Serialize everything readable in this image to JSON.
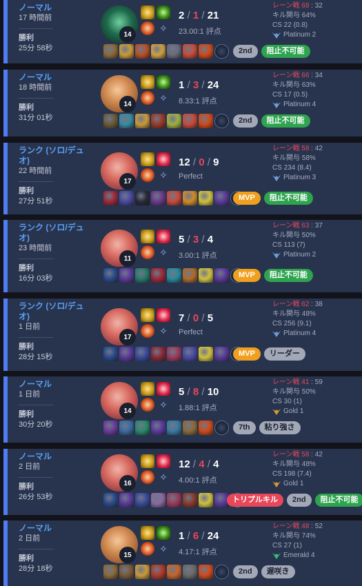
{
  "colors": {
    "accent": "#4f7ef4",
    "kill_death_red": "#e8475a",
    "mvp_orange": "#f0a01e",
    "unstoppable_green": "#2ea44f",
    "card_bg": "#28344e"
  },
  "matches": [
    {
      "mode": "ノーマル",
      "ago": "17 時間前",
      "result": "勝利",
      "duration": "25分 58秒",
      "champion": "green-champion-portrait",
      "level": "14",
      "spells": [
        "flash",
        "smite"
      ],
      "runes": [
        "keystone-rune",
        "secondary-rune"
      ],
      "kda": {
        "k": "2",
        "d": "1",
        "a": "21"
      },
      "ratio": "23.00:1 評点",
      "lane": "レーン戦 68",
      "lane_vs": "32",
      "kp": "キル関与 64%",
      "cs": "CS 22 (0.8)",
      "tier": "Platinum 2",
      "tier_color": "#6f9fd8",
      "items": [
        "#8a6a3a",
        "#c99a3a",
        "#b8502a",
        "#d0a040",
        "#6a6a7a",
        "#c84a3a",
        "#d04a1a"
      ],
      "badges": [
        {
          "text": "2nd",
          "style": "grey"
        },
        {
          "text": "阻止不可能",
          "style": "green"
        }
      ]
    },
    {
      "mode": "ノーマル",
      "ago": "18 時間前",
      "result": "勝利",
      "duration": "31分 01秒",
      "champion": "blonde-champion-portrait",
      "level": "14",
      "spells": [
        "flash",
        "smite"
      ],
      "runes": [
        "keystone-rune",
        "secondary-rune"
      ],
      "kda": {
        "k": "1",
        "d": "3",
        "a": "24"
      },
      "ratio": "8.33:1 評点",
      "lane": "レーン戦 66",
      "lane_vs": "34",
      "kp": "キル関与 63%",
      "cs": "CS 17 (0.5)",
      "tier": "Platinum 4",
      "tier_color": "#6f9fd8",
      "items": [
        "#6a5a3a",
        "#3a8aa0",
        "#c99a3a",
        "#9a3a2a",
        "#a0b040",
        "#c84a3a",
        "#d04a1a"
      ],
      "badges": [
        {
          "text": "2nd",
          "style": "grey"
        },
        {
          "text": "阻止不可能",
          "style": "green"
        }
      ]
    },
    {
      "mode": "ランク (ソロ/デュオ)",
      "ago": "22 時間前",
      "result": "勝利",
      "duration": "27分 51秒",
      "champion": "pink-champion-portrait",
      "level": "17",
      "spells": [
        "flash",
        "heal"
      ],
      "runes": [
        "keystone-rune",
        "secondary-rune"
      ],
      "kda": {
        "k": "12",
        "d": "0",
        "a": "9"
      },
      "ratio": "Perfect",
      "lane": "レーン戦 58",
      "lane_vs": "42",
      "kp": "キル関与 58%",
      "cs": "CS 234 (8.4)",
      "tier": "Platinum 3",
      "tier_color": "#6f9fd8",
      "items": [
        "#9a2a3a",
        "#4a4aa0",
        "#2a2a3a",
        "#6a3a8a",
        "#c84a3a",
        "#d08a2a",
        "#d0c040",
        "#5a3a9a"
      ],
      "badges": [
        {
          "text": "MVP",
          "style": "orange"
        },
        {
          "text": "阻止不可能",
          "style": "green"
        }
      ]
    },
    {
      "mode": "ランク (ソロ/デュオ)",
      "ago": "23 時間前",
      "result": "勝利",
      "duration": "16分 03秒",
      "champion": "pink-champion-portrait",
      "level": "11",
      "spells": [
        "flash",
        "heal"
      ],
      "runes": [
        "keystone-rune",
        "secondary-rune"
      ],
      "kda": {
        "k": "5",
        "d": "3",
        "a": "4"
      },
      "ratio": "3.00:1 評点",
      "lane": "レーン戦 63",
      "lane_vs": "37",
      "kp": "キル関与 50%",
      "cs": "CS 113 (7)",
      "tier": "Platinum 2",
      "tier_color": "#6f9fd8",
      "items": [
        "#2a4a8a",
        "#5a3a9a",
        "#2a7a6a",
        "#9a2a3a",
        "#2a8a9a",
        "#b06a2a",
        "#d0c040",
        "#5a3a9a"
      ],
      "badges": [
        {
          "text": "MVP",
          "style": "orange"
        },
        {
          "text": "阻止不可能",
          "style": "green"
        }
      ]
    },
    {
      "mode": "ランク (ソロ/デュオ)",
      "ago": "1 日前",
      "result": "勝利",
      "duration": "28分 15秒",
      "champion": "pink-champion-portrait",
      "level": "17",
      "spells": [
        "flash",
        "heal"
      ],
      "runes": [
        "keystone-rune",
        "secondary-rune"
      ],
      "kda": {
        "k": "7",
        "d": "0",
        "a": "5"
      },
      "ratio": "Perfect",
      "lane": "レーン戦 62",
      "lane_vs": "38",
      "kp": "キル関与 48%",
      "cs": "CS 256 (9.1)",
      "tier": "Platinum 4",
      "tier_color": "#6f9fd8",
      "items": [
        "#2a4a8a",
        "#5a3a9a",
        "#3a4a9a",
        "#8a2a3a",
        "#9a3a5a",
        "#4a4aa0",
        "#d0c040",
        "#5a3a9a"
      ],
      "badges": [
        {
          "text": "MVP",
          "style": "orange"
        },
        {
          "text": "リーダー",
          "style": "grey"
        }
      ]
    },
    {
      "mode": "ノーマル",
      "ago": "1 日前",
      "result": "勝利",
      "duration": "30分 20秒",
      "champion": "pink-champion-portrait",
      "level": "14",
      "spells": [
        "flash",
        "heal"
      ],
      "runes": [
        "keystone-rune",
        "secondary-rune"
      ],
      "kda": {
        "k": "5",
        "d": "8",
        "a": "10"
      },
      "ratio": "1.88:1 評点",
      "lane": "レーン戦 41",
      "lane_vs": "59",
      "kp": "キル関与 50%",
      "cs": "CS 30 (1)",
      "tier": "Gold 1",
      "tier_color": "#d89a3a",
      "items": [
        "#6a3a9a",
        "#3a6aa0",
        "#2a8a6a",
        "#5a3a9a",
        "#3a7aa0",
        "#8a6a3a",
        "#d04a1a"
      ],
      "badges": [
        {
          "text": "7th",
          "style": "grey"
        },
        {
          "text": "粘り強さ",
          "style": "grey"
        }
      ]
    },
    {
      "mode": "ノーマル",
      "ago": "2 日前",
      "result": "勝利",
      "duration": "26分 53秒",
      "champion": "pink-champion-portrait",
      "level": "16",
      "spells": [
        "flash",
        "heal"
      ],
      "runes": [
        "keystone-rune",
        "secondary-rune"
      ],
      "kda": {
        "k": "12",
        "d": "4",
        "a": "4"
      },
      "ratio": "4.00:1 評点",
      "lane": "レーン戦 58",
      "lane_vs": "42",
      "kp": "キル関与 48%",
      "cs": "CS 198 (7.4)",
      "tier": "Gold 1",
      "tier_color": "#d89a3a",
      "items": [
        "#2a4a8a",
        "#5a3a9a",
        "#3a4a9a",
        "#8a6aa0",
        "#9a3a5a",
        "#8a3a2a",
        "#d0c040",
        "#5a3a9a"
      ],
      "badges": [
        {
          "text": "トリプルキル",
          "style": "red"
        },
        {
          "text": "2nd",
          "style": "grey"
        },
        {
          "text": "阻止不可能",
          "style": "green"
        }
      ]
    },
    {
      "mode": "ノーマル",
      "ago": "2 日前",
      "result": "勝利",
      "duration": "28分 18秒",
      "champion": "blonde-champion-portrait",
      "level": "15",
      "spells": [
        "flash",
        "smite"
      ],
      "runes": [
        "keystone-rune",
        "secondary-rune"
      ],
      "kda": {
        "k": "1",
        "d": "6",
        "a": "24"
      },
      "ratio": "4.17:1 評点",
      "lane": "レーン戦 48",
      "lane_vs": "52",
      "kp": "キル関与 74%",
      "cs": "CS 27 (1)",
      "tier": "Emerald 4",
      "tier_color": "#3ac07a",
      "items": [
        "#8a6a3a",
        "#7a5a3a",
        "#c99a3a",
        "#b03a2a",
        "#c8642a",
        "#6a6a6a",
        "#d04a1a"
      ],
      "badges": [
        {
          "text": "2nd",
          "style": "grey"
        },
        {
          "text": "遅咲き",
          "style": "grey"
        }
      ]
    }
  ]
}
